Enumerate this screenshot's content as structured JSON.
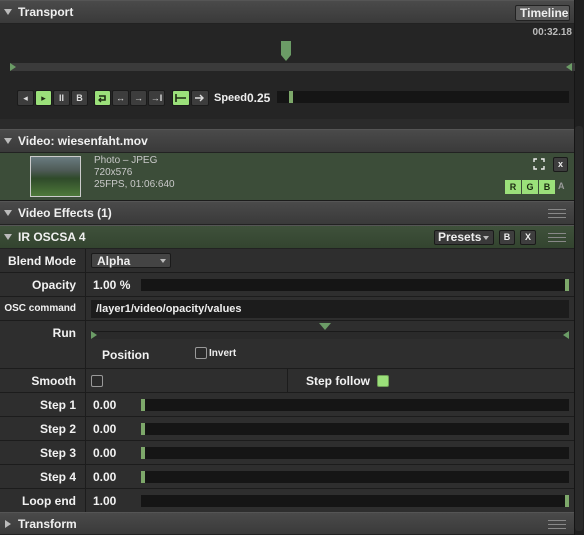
{
  "transport": {
    "title": "Transport",
    "mode_select": "Timeline",
    "timecode": "00:32.18",
    "controls": {
      "prev_icon": "◂",
      "play_icon": "▸",
      "pause_icon": "II",
      "b_label": "B",
      "loop_icon": "loop-icon",
      "bounce_icon": "↔",
      "once_icon": "→",
      "once_stop_icon": "→I",
      "speed_label": "Speed",
      "speed_value": "0.25",
      "speed_fraction": 0.04
    }
  },
  "video": {
    "title": "Video: wiesenfaht.mov",
    "type": "Photo – JPEG",
    "resolution": "720x576",
    "fps_duration": "25FPS, 01:06:640",
    "rgb": [
      "R",
      "G",
      "B"
    ],
    "alpha": "A"
  },
  "video_effects": {
    "title": "Video Effects (1)"
  },
  "effect": {
    "title": "IR OSCSA 4",
    "presets_label": "Presets",
    "b_label": "B",
    "x_label": "X",
    "rows": {
      "blend_mode": {
        "label": "Blend Mode",
        "value": "Alpha"
      },
      "opacity": {
        "label": "Opacity",
        "value": "1.00 %",
        "fraction": 1.0
      },
      "osc_command": {
        "label": "OSC command",
        "value": "/layer1/video/opacity/values"
      },
      "run": {
        "label": "Run",
        "position_label": "Position",
        "invert_label": "Invert"
      },
      "smooth": {
        "label": "Smooth",
        "checked": false,
        "step_follow_label": "Step follow",
        "step_follow_checked": true
      },
      "steps": [
        {
          "label": "Step 1",
          "value": "0.00"
        },
        {
          "label": "Step 2",
          "value": "0.00"
        },
        {
          "label": "Step 3",
          "value": "0.00"
        },
        {
          "label": "Step 4",
          "value": "0.00"
        }
      ],
      "loop_end": {
        "label": "Loop end",
        "value": "1.00",
        "fraction": 1.0
      }
    }
  },
  "transform": {
    "title": "Transform"
  },
  "colors": {
    "accent_green": "#9be07a",
    "panel_green": "#3d4f3a",
    "header_gray": "#424242"
  }
}
